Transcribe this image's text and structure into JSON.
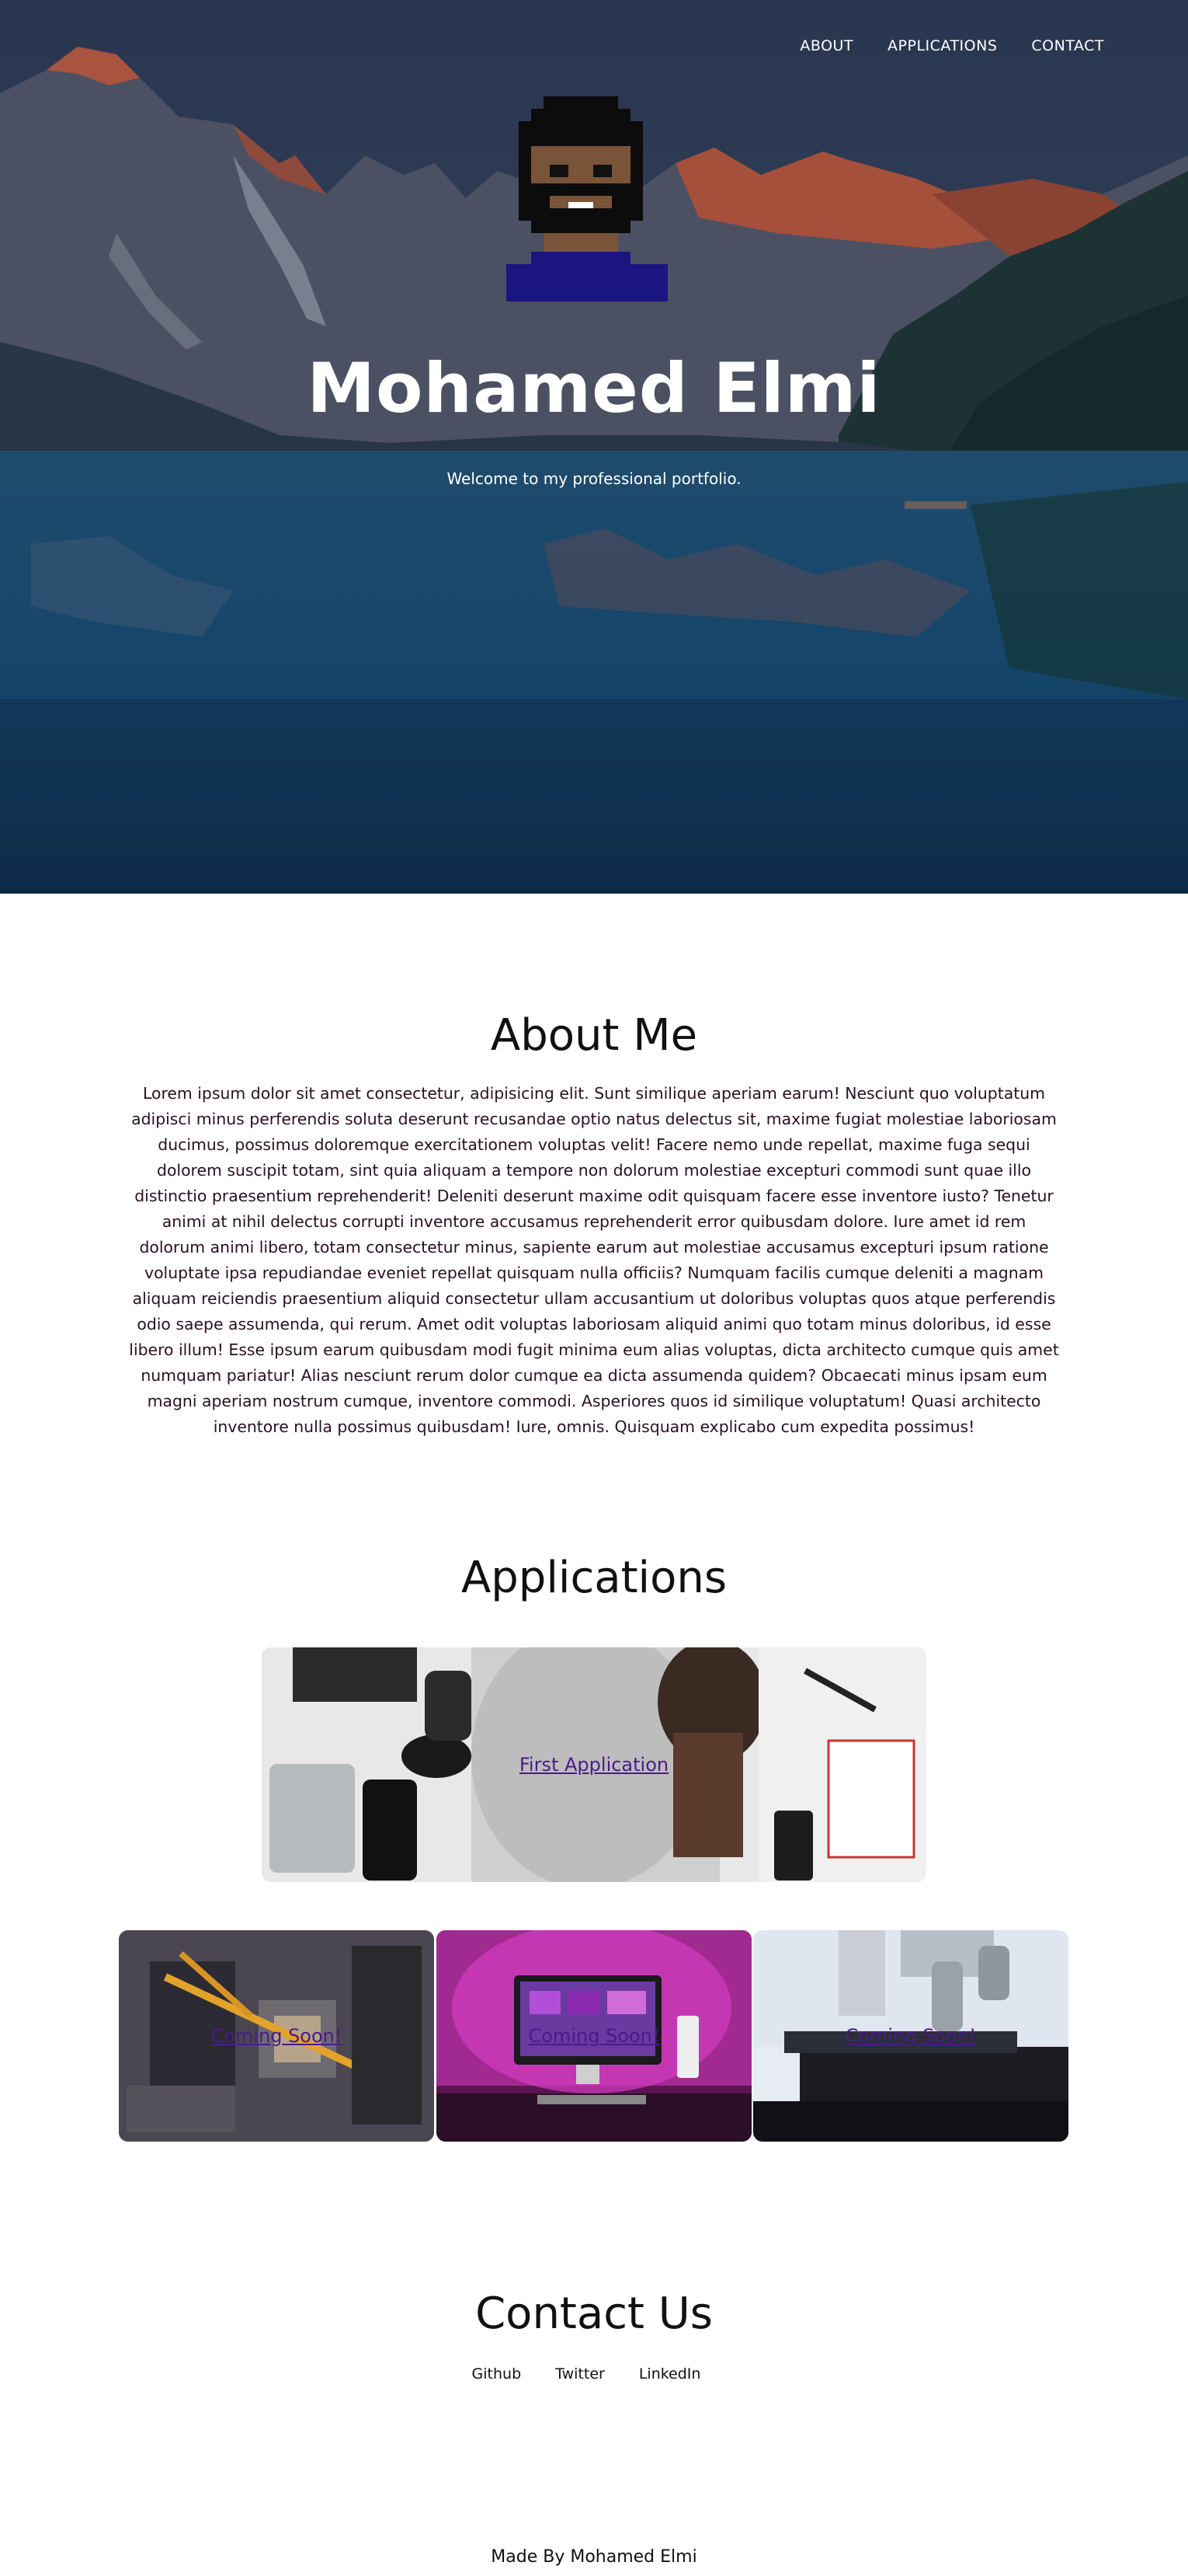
{
  "nav": {
    "items": [
      {
        "label": "ABOUT"
      },
      {
        "label": "APPLICATIONS"
      },
      {
        "label": "CONTACT"
      }
    ]
  },
  "hero": {
    "title": "Mohamed Elmi",
    "subtitle": "Welcome to my professional portfolio."
  },
  "about": {
    "heading": "About Me",
    "body": "Lorem ipsum dolor sit amet consectetur, adipisicing elit. Sunt similique aperiam earum! Nesciunt quo voluptatum adipisci minus perferendis soluta deserunt recusandae optio natus delectus sit, maxime fugiat molestiae laboriosam ducimus, possimus doloremque exercitationem voluptas velit! Facere nemo unde repellat, maxime fuga sequi dolorem suscipit totam, sint quia aliquam a tempore non dolorum molestiae excepturi commodi sunt quae illo distinctio praesentium reprehenderit! Deleniti deserunt maxime odit quisquam facere esse inventore iusto? Tenetur animi at nihil delectus corrupti inventore accusamus reprehenderit error quibusdam dolore. Iure amet id rem dolorum animi libero, totam consectetur minus, sapiente earum aut molestiae accusamus excepturi ipsum ratione voluptate ipsa repudiandae eveniet repellat quisquam nulla officiis? Numquam facilis cumque deleniti a magnam aliquam reiciendis praesentium aliquid consectetur ullam accusantium ut doloribus voluptas quos atque perferendis odio saepe assumenda, qui rerum. Amet odit voluptas laboriosam aliquid animi quo totam minus doloribus, id esse libero illum! Esse ipsum earum quibusdam modi fugit minima eum alias voluptas, dicta architecto cumque quis amet numquam pariatur! Alias nesciunt rerum dolor cumque ea dicta assumenda quidem? Obcaecati minus ipsam eum magni aperiam nostrum cumque, inventore commodi. Asperiores quos id similique voluptatum! Quasi architecto inventore nulla possimus quibusdam! Iure, omnis. Quisquam explicabo cum expedita possimus!"
  },
  "applications": {
    "heading": "Applications",
    "featured": {
      "label": "First Application"
    },
    "cards": [
      {
        "label": "Coming Soon!"
      },
      {
        "label": "Coming Soon!"
      },
      {
        "label": "Coming Soon!"
      }
    ]
  },
  "contact": {
    "heading": "Contact Us",
    "links": [
      {
        "label": "Github"
      },
      {
        "label": "Twitter"
      },
      {
        "label": "LinkedIn"
      }
    ]
  },
  "footer": {
    "text": "Made By Mohamed Elmi"
  },
  "colors": {
    "link": "#4b1a8a",
    "hero_text": "#ffffff",
    "body_text": "#111111"
  }
}
